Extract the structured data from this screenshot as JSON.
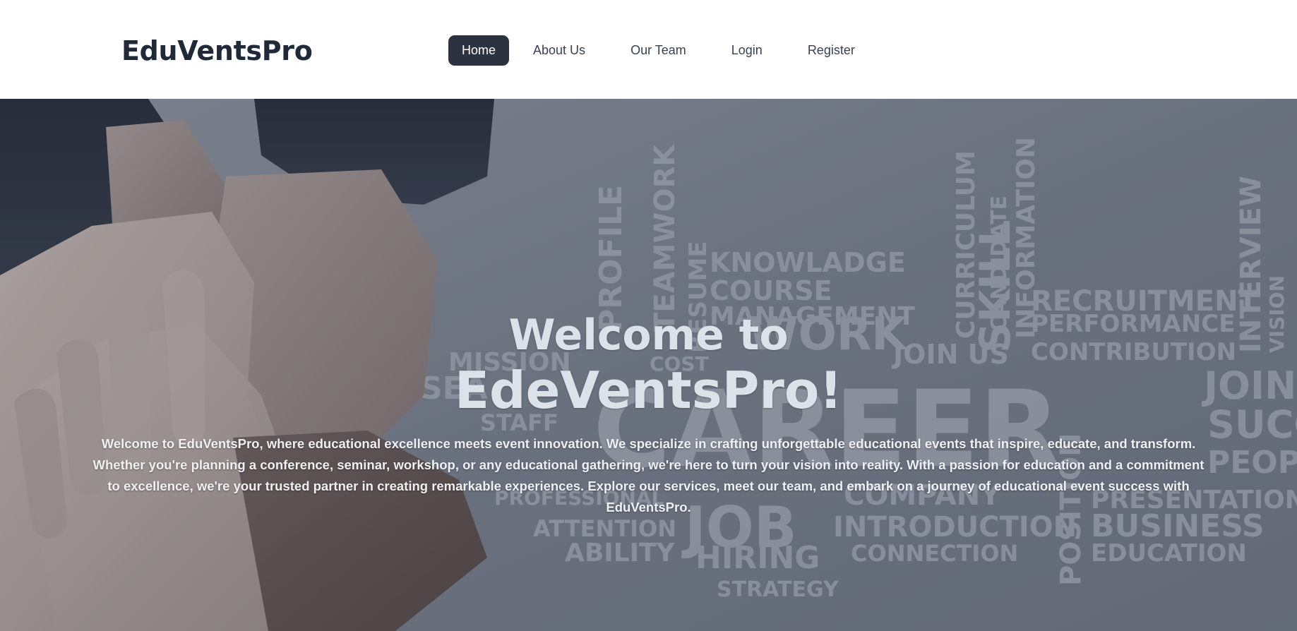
{
  "header": {
    "brand": "EduVentsPro",
    "nav": [
      {
        "label": "Home",
        "active": true
      },
      {
        "label": "About Us",
        "active": false
      },
      {
        "label": "Our Team",
        "active": false
      },
      {
        "label": "Login",
        "active": false
      },
      {
        "label": "Register",
        "active": false
      }
    ]
  },
  "hero": {
    "title_line1": "Welcome to",
    "title_line2": "EdeVentsPro!",
    "description": "Welcome to EduVentsPro, where educational excellence meets event innovation. We specialize in crafting unforgettable educational events that inspire, educate, and transform. Whether you're planning a conference, seminar, workshop, or any educational gathering, we're here to turn your vision into reality. With a passion for education and a commitment to excellence, we're your trusted partner in creating remarkable experiences. Explore our services, meet our team, and embark on a journey of educational event success with EduVentsPro.",
    "background_words": [
      "KNOWLADGE",
      "COURSE",
      "MANAGEMENT",
      "WORK",
      "JOIN US",
      "CURRICULUM",
      "SKILL",
      "CANDIDATE",
      "INFORMATION",
      "RECRUITMENT",
      "PERFORMANCE",
      "CONTRIBUTION",
      "INTERVIEW",
      "VISION",
      "MISSION",
      "SEA",
      "STAFF",
      "COST",
      "TEAMWORK",
      "RESUME",
      "PROFILE",
      "CAREER",
      "JOIN",
      "SUCC",
      "PEOPL",
      "PRESENTATION",
      "BUSINESS",
      "EDUCATION",
      "COMPANY",
      "INTRODUCTION",
      "CONNECTION",
      "ATTENTION",
      "ABILITY",
      "HIRING",
      "STRATEGY",
      "JOB",
      "PROFESSIONAL",
      "POSITION"
    ],
    "colors": {
      "overlay": "#6b7280",
      "title": "#dde1e8",
      "nav_active_bg": "#2b3240",
      "brand": "#1f2937"
    }
  }
}
